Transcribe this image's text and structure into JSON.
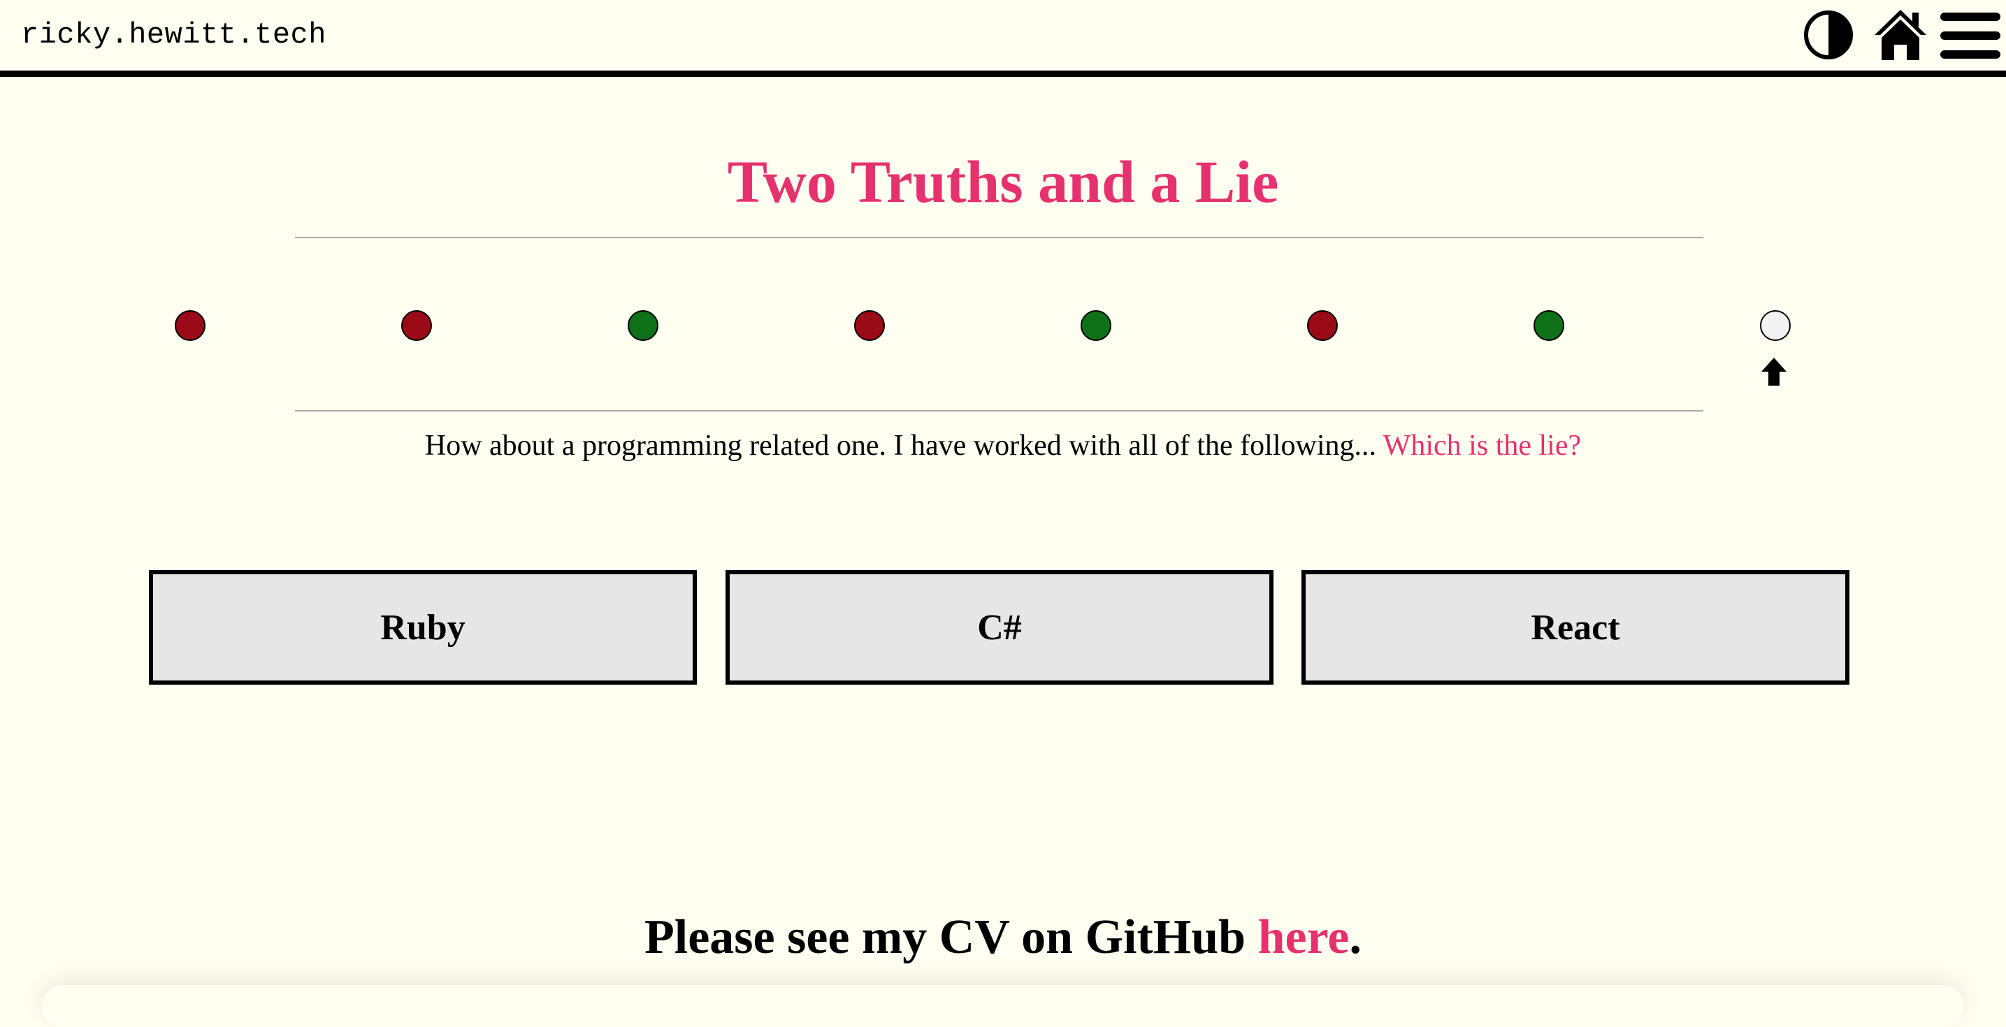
{
  "header": {
    "site_name": "ricky.hewitt.tech",
    "icons": [
      "theme-toggle-icon",
      "home-icon",
      "menu-icon"
    ]
  },
  "main": {
    "title": "Two Truths and a Lie",
    "progress": {
      "rounds": [
        {
          "status": "wrong",
          "color": "#9b0a17"
        },
        {
          "status": "wrong",
          "color": "#9b0a17"
        },
        {
          "status": "correct",
          "color": "#0e7117"
        },
        {
          "status": "wrong",
          "color": "#9b0a17"
        },
        {
          "status": "correct",
          "color": "#0e7117"
        },
        {
          "status": "wrong",
          "color": "#9b0a17"
        },
        {
          "status": "correct",
          "color": "#0e7117"
        },
        {
          "status": "current",
          "color": "#f2f2f2"
        }
      ],
      "current_index": 8
    },
    "question": {
      "text": "How about a programming related one. I have worked with all of the following...",
      "prompt": "Which is the lie?"
    },
    "answers": [
      "Ruby",
      "C#",
      "React"
    ]
  },
  "footer": {
    "cv_text": "Please see my CV on GitHub",
    "cv_link": "here",
    "cv_end": "."
  },
  "colors": {
    "accent": "#e5326f",
    "background": "#fffff1",
    "button_bg": "#e6e6e6"
  }
}
